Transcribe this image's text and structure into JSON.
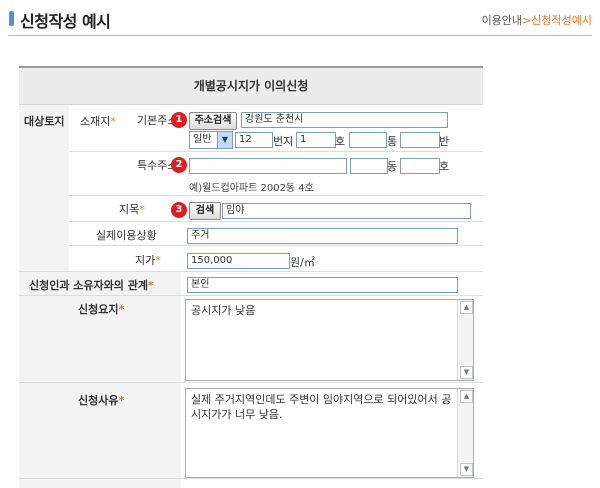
{
  "header": {
    "title": "신청작성 예시",
    "breadcrumb_parent": "이용안내",
    "breadcrumb_sep": ">",
    "breadcrumb_current": "신청작성예시"
  },
  "form": {
    "title": "개별공시지가 이의신청",
    "section_target": "대상토지",
    "location_label": "소재지",
    "required_mark": "*",
    "basic_address_label": "기본주소",
    "badge1": "1",
    "address_search_button": "주소검색",
    "address_value": "강원도 춘천시",
    "lot_type_select": "일반",
    "lot_main_value": "12",
    "lot_label": "번지",
    "ho_value": "1",
    "ho_label": "호",
    "tong_value": "",
    "tong_label": "통",
    "ban_value": "",
    "ban_label": "반",
    "special_address_label": "특수주소",
    "badge2": "2",
    "special_value": "",
    "dong_value": "",
    "dong_label": "동",
    "special_ho_value": "",
    "special_ho_label": "호",
    "special_example": "예)월드컵아파트 2002동 4호",
    "jimok_label": "지목",
    "badge3": "3",
    "jimok_search_button": "검색",
    "jimok_value": "임야",
    "usage_label": "실제이용상황",
    "usage_value": "주거",
    "price_label": "지가",
    "price_value": "150,000",
    "price_unit": "원/㎡",
    "relation_label": "신청인과 소유자와의 관계",
    "relation_value": "본인",
    "summary_label": "신청요지",
    "summary_value": "공시지가 낮음",
    "reason_label": "신청사유",
    "reason_value": "실제 주거지역인데도 주변이 임야지역으로 되어있어서 공시지가가 너무 낮음."
  },
  "colors": {
    "accent": "#e8772e",
    "badge": "#d9201f",
    "title_bar": "#5b8fd0"
  },
  "icons": {
    "scroll_up": "▲",
    "scroll_down": "▼",
    "select_arrow": "▼"
  }
}
